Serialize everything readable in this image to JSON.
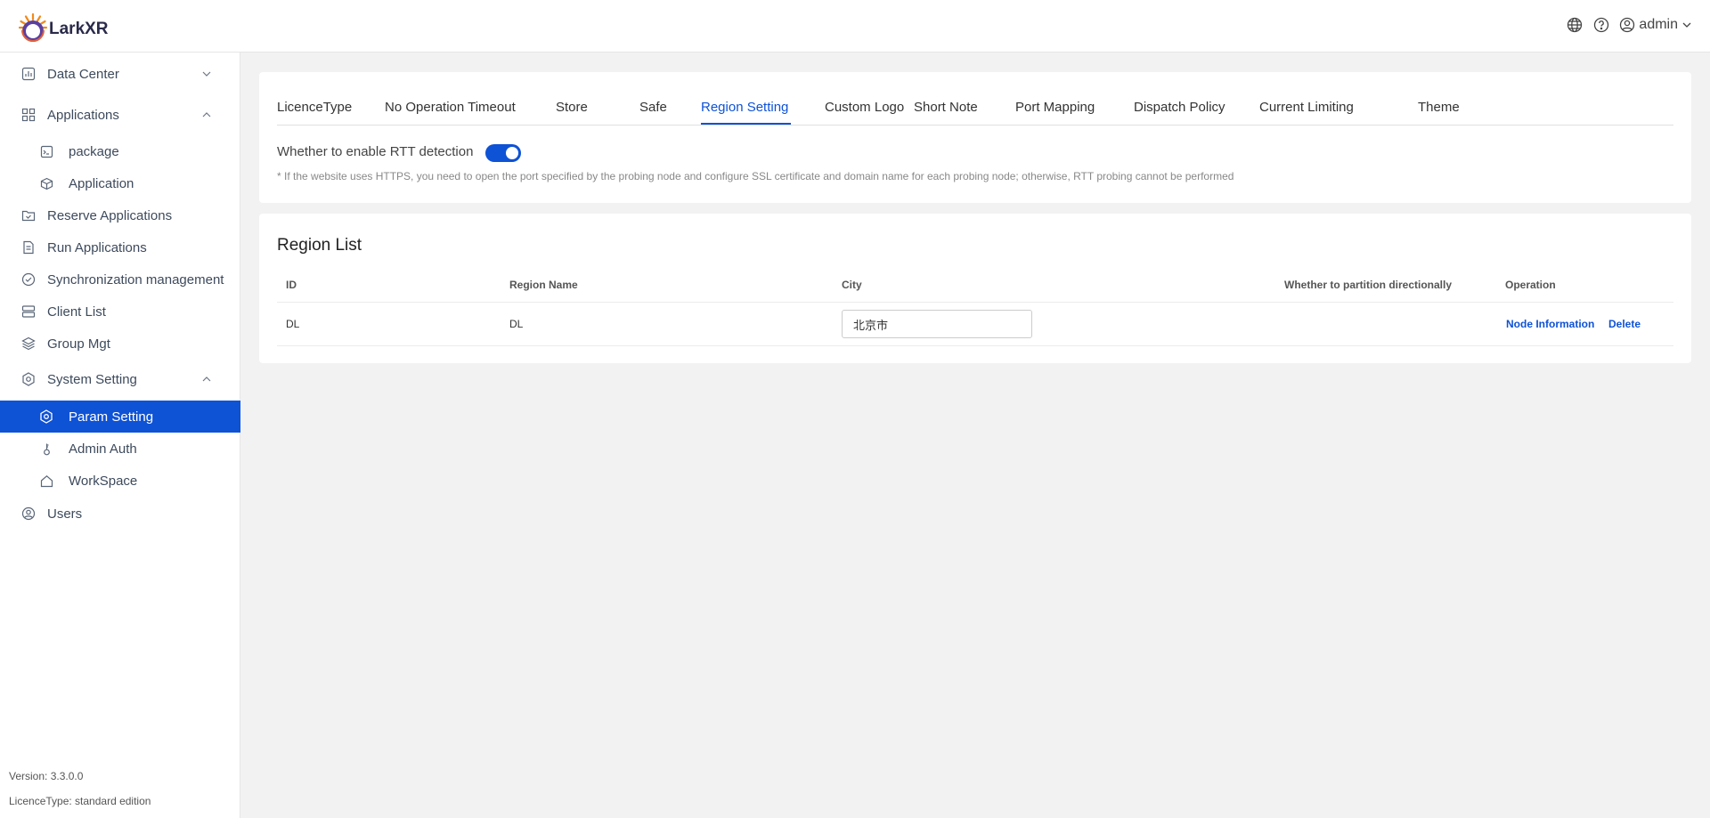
{
  "app": {
    "name": "LarkXR",
    "user": "admin"
  },
  "header": {
    "icons": [
      "globe-icon",
      "help-icon",
      "user-circle-icon",
      "chevron-down-icon"
    ]
  },
  "sidebar": {
    "items": [
      {
        "label": "Data Center",
        "icon": "chart-icon",
        "expandable": true,
        "expanded": false
      },
      {
        "label": "Applications",
        "icon": "grid-icon",
        "expandable": true,
        "expanded": true
      },
      {
        "label": "package",
        "icon": "package-icon",
        "sub": true
      },
      {
        "label": "Application",
        "icon": "cube-icon",
        "sub": true
      },
      {
        "label": "Reserve Applications",
        "icon": "reserve-icon"
      },
      {
        "label": "Run Applications",
        "icon": "document-icon"
      },
      {
        "label": "Synchronization management",
        "icon": "check-circle-icon"
      },
      {
        "label": "Client List",
        "icon": "server-icon"
      },
      {
        "label": "Group Mgt",
        "icon": "layers-icon"
      },
      {
        "label": "System Setting",
        "icon": "settings-icon",
        "expandable": true,
        "expanded": true
      },
      {
        "label": "Param Setting",
        "icon": "settings-icon",
        "sub": true,
        "active": true
      },
      {
        "label": "Admin Auth",
        "icon": "key-icon",
        "sub": true
      },
      {
        "label": "WorkSpace",
        "icon": "home-icon",
        "sub": true
      },
      {
        "label": "Users",
        "icon": "user-circle-icon"
      }
    ],
    "version": "Version: 3.3.0.0",
    "licence": "LicenceType: standard edition"
  },
  "tabs": [
    "LicenceType",
    "No Operation Timeout",
    "Store",
    "Safe",
    "Region Setting",
    "Custom Logo",
    "Short Note",
    "Port Mapping",
    "Dispatch Policy",
    "Current Limiting",
    "Theme"
  ],
  "active_tab": "Region Setting",
  "rtt": {
    "label": "Whether to enable RTT detection",
    "enabled": true,
    "hint": "* If the website uses HTTPS, you need to open the port specified by the probing node and configure SSL certificate and domain name for each probing node; otherwise, RTT probing cannot be performed"
  },
  "region_list": {
    "title": "Region List",
    "columns": [
      "ID",
      "Region Name",
      "City",
      "Whether to partition directionally",
      "Operation"
    ],
    "rows": [
      {
        "id": "DL",
        "region_name": "DL",
        "city": "北京市",
        "node_info": "Node Information",
        "delete": "Delete"
      }
    ]
  },
  "colors": {
    "primary": "#0e52d6",
    "logo_orange": "#f08a1c",
    "logo_purple": "#5a3fa0"
  }
}
